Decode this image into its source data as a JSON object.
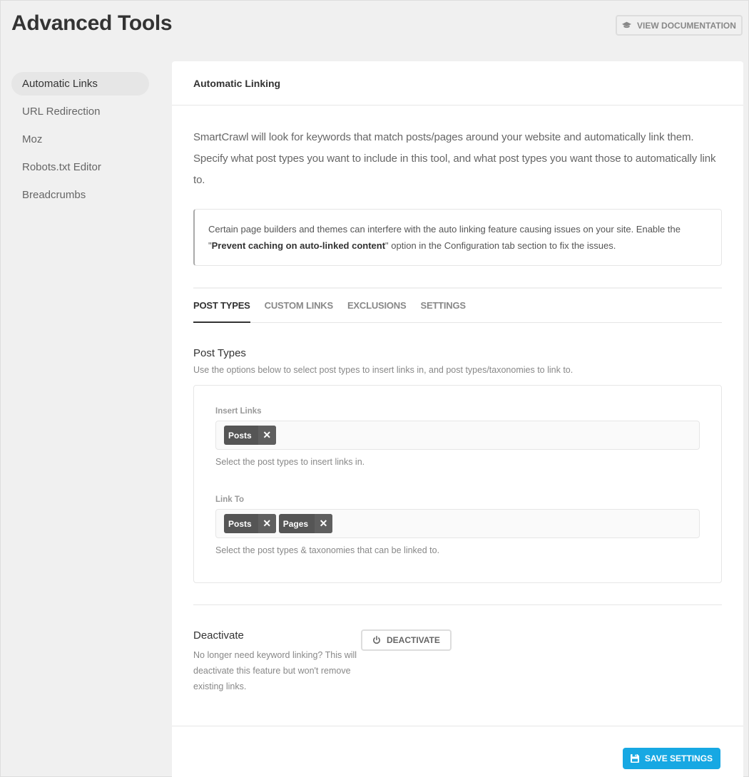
{
  "page": {
    "title": "Advanced Tools",
    "doc_button": "VIEW DOCUMENTATION",
    "doc_icon": "graduation-cap-icon"
  },
  "sidebar": {
    "items": [
      {
        "label": "Automatic Links",
        "active": true
      },
      {
        "label": "URL Redirection",
        "active": false
      },
      {
        "label": "Moz",
        "active": false
      },
      {
        "label": "Robots.txt Editor",
        "active": false
      },
      {
        "label": "Breadcrumbs",
        "active": false
      }
    ]
  },
  "card": {
    "title": "Automatic Linking",
    "intro": "SmartCrawl will look for keywords that match posts/pages around your website and automatically link them. Specify what post types you want to include in this tool, and what post types you want those to automatically link to.",
    "notice": {
      "before": "Certain page builders and themes can interfere with the auto linking feature causing issues on your site. Enable the \"",
      "bold": "Prevent caching on auto-linked content",
      "after": "\" option in the Configuration tab section to fix the issues."
    },
    "tabs": [
      {
        "label": "POST TYPES",
        "active": true
      },
      {
        "label": "CUSTOM LINKS",
        "active": false
      },
      {
        "label": "EXCLUSIONS",
        "active": false
      },
      {
        "label": "SETTINGS",
        "active": false
      }
    ],
    "post_types": {
      "title": "Post Types",
      "description": "Use the options below to select post types to insert links in, and post types/taxonomies to link to.",
      "insert_links": {
        "label": "Insert Links",
        "tags": [
          "Posts"
        ],
        "help": "Select the post types to insert links in."
      },
      "link_to": {
        "label": "Link To",
        "tags": [
          "Posts",
          "Pages"
        ],
        "help": "Select the post types & taxonomies that can be linked to."
      },
      "remove_glyph": "✕"
    },
    "deactivate": {
      "title": "Deactivate",
      "description": "No longer need keyword linking? This will deactivate this feature but won't remove existing links.",
      "button": "DEACTIVATE",
      "icon": "power-icon"
    },
    "save_button": "SAVE SETTINGS",
    "save_icon": "floppy-disk-icon"
  },
  "colors": {
    "accent": "#17a8e3",
    "tag_bg": "#555555",
    "page_bg": "#f0f0f0"
  }
}
